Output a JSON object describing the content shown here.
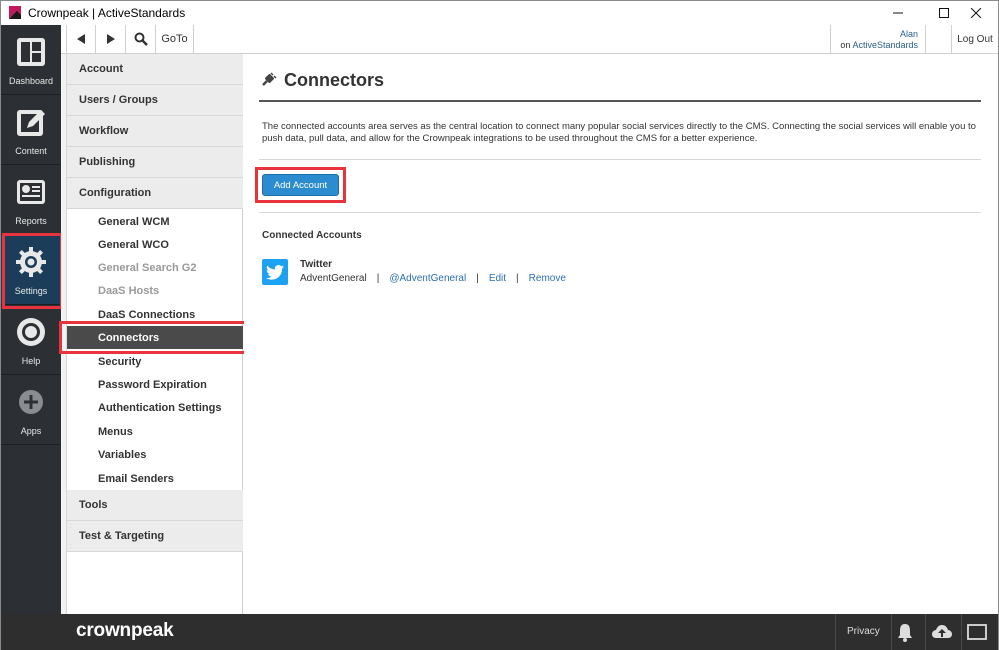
{
  "window": {
    "title": "Crownpeak | ActiveStandards",
    "brand_colors": {
      "magenta": "#c2185b",
      "black": "#1a1a1a"
    }
  },
  "leftnav": {
    "items": [
      {
        "label": "Dashboard",
        "icon": "dashboard-icon"
      },
      {
        "label": "Content",
        "icon": "edit-icon"
      },
      {
        "label": "Reports",
        "icon": "reports-icon"
      },
      {
        "label": "Settings",
        "icon": "gear-icon",
        "active": true
      },
      {
        "label": "Help",
        "icon": "lifebuoy-icon"
      },
      {
        "label": "Apps",
        "icon": "plus-circle-icon"
      }
    ],
    "active_color": "#1b3d59"
  },
  "toolbar": {
    "back_icon": "back-arrow-icon",
    "forward_icon": "forward-arrow-icon",
    "search_icon": "search-icon",
    "goto_label": "GoTo",
    "user_name": "Alan",
    "user_on_prefix": "on",
    "user_org": "ActiveStandards",
    "logout_label": "Log Out"
  },
  "sidebar": {
    "sections": [
      "Account",
      "Users / Groups",
      "Workflow",
      "Publishing",
      "Configuration"
    ],
    "config_items": [
      {
        "label": "General WCM"
      },
      {
        "label": "General WCO"
      },
      {
        "label": "General Search G2",
        "disabled": true
      },
      {
        "label": "DaaS Hosts",
        "disabled": true
      },
      {
        "label": "DaaS Connections"
      },
      {
        "label": "Connectors",
        "active": true
      },
      {
        "label": "Security"
      },
      {
        "label": "Password Expiration"
      },
      {
        "label": "Authentication Settings"
      },
      {
        "label": "Menus"
      },
      {
        "label": "Variables"
      },
      {
        "label": "Email Senders"
      }
    ],
    "bottom_sections": [
      "Tools",
      "Test & Targeting"
    ]
  },
  "main": {
    "title": "Connectors",
    "title_icon": "plug-icon",
    "description": "The connected accounts area serves as the central location to connect many popular social services directly to the CMS. Connecting the social services will enable you to push data, pull data, and allow for the Crownpeak integrations to be used throughout the CMS for a better experience.",
    "add_button": "Add Account",
    "connected_heading": "Connected Accounts",
    "accounts": [
      {
        "service": "Twitter",
        "service_icon": "twitter-icon",
        "name": "AdventGeneral",
        "handle": "@AdventGeneral",
        "edit_label": "Edit",
        "remove_label": "Remove",
        "separator": "|"
      }
    ],
    "accent_color": "#2b8ccf",
    "highlight_color": "#e8333c"
  },
  "footer": {
    "brand": "crownpeak",
    "privacy_label": "Privacy",
    "bell_icon": "bell-icon",
    "upload_icon": "cloud-upload-icon",
    "fullscreen_icon": "fullscreen-icon"
  }
}
